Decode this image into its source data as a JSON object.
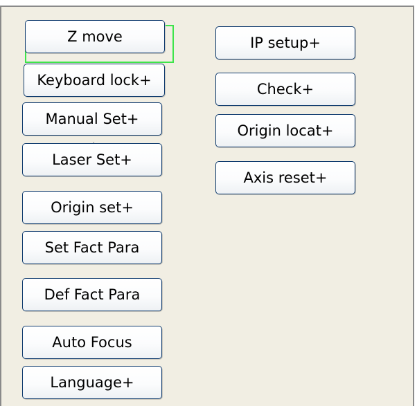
{
  "menu": {
    "left": [
      {
        "key": "z_move",
        "label": "Z  move"
      },
      {
        "key": "keyboard_lock",
        "label": "Keyboard lock+"
      },
      {
        "key": "manual_set",
        "label": "Manual Set+"
      },
      {
        "key": "laser_set",
        "label": "Laser Set+"
      },
      {
        "key": "origin_set",
        "label": "Origin set+"
      },
      {
        "key": "set_fact_para",
        "label": "Set Fact Para"
      },
      {
        "key": "def_fact_para",
        "label": "Def Fact Para"
      },
      {
        "key": "auto_focus",
        "label": "Auto Focus"
      },
      {
        "key": "language",
        "label": "Language+"
      }
    ],
    "right": [
      {
        "key": "ip_setup",
        "label": "IP setup+"
      },
      {
        "key": "check",
        "label": "Check+"
      },
      {
        "key": "origin_locat",
        "label": "Origin locat+"
      },
      {
        "key": "axis_reset",
        "label": "Axis reset+"
      }
    ]
  },
  "selected": "Z  move",
  "colors": {
    "panel_bg": "#f1eee3",
    "button_border": "#0f3b6e",
    "focus": "#3ee44a"
  }
}
